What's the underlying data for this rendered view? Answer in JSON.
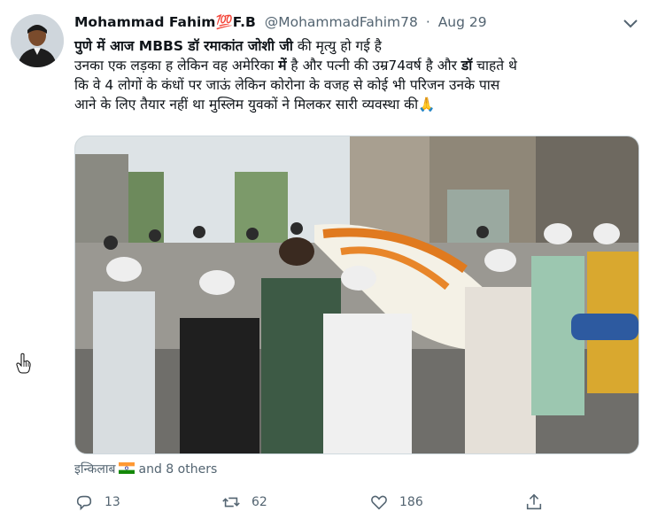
{
  "tweet": {
    "author_name": "Mohammad Fahim💯F.B",
    "handle": "@MohammadFahim78",
    "separator": "·",
    "date": "Aug 29",
    "text_line1": "पुणे में आज MBBS डॉ रमाकांत जोशी जी",
    "text_line1_rest": " की  मृत्यु हो गई है",
    "text_line2a": "उनका एक लड़का ह लेकिन वह अमेरिका ",
    "text_line2b": "में",
    "text_line2c": " है और पत्नी की उम्र74वर्ष है और ",
    "text_line2d": "डॉ",
    "text_line2e": " चाहते थे",
    "text_line3": "कि वे 4 लोगों के कंधों पर जाऊं लेकिन कोरोना के वजह से कोई भी परिजन उनके पास",
    "text_line4": "आने के लिए तैयार नहीं था मुस्लिम युवकों ने मिलकर सारी व्यवस्था की🙏",
    "liked_by": "इन्किलाब",
    "liked_others": "and 8 others",
    "reply_count": "13",
    "retweet_count": "62",
    "like_count": "186"
  },
  "icons": {
    "more": "chevron-down-icon",
    "reply": "reply-icon",
    "retweet": "retweet-icon",
    "like": "heart-icon",
    "share": "share-icon",
    "flag": "india-flag-icon",
    "cursor": "hand-cursor-icon"
  },
  "colors": {
    "text": "#0f1419",
    "muted": "#536471",
    "border": "#cfd9de"
  }
}
